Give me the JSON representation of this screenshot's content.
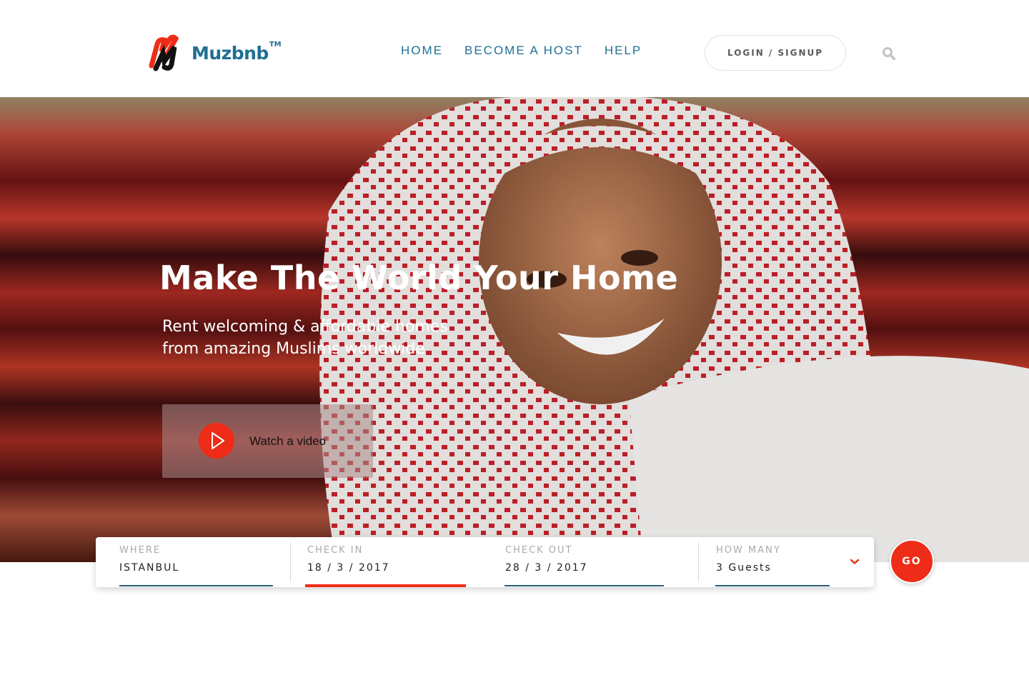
{
  "brand": {
    "name": "Muzbnb",
    "trademark": "TM",
    "primary_color": "#1f6f93",
    "accent_color": "#ee2c17"
  },
  "nav": {
    "items": [
      {
        "label": "HOME"
      },
      {
        "label": "BECOME A HOST"
      },
      {
        "label": "HELP"
      }
    ],
    "login_label": "LOGIN / SIGNUP",
    "search_icon": "search-icon"
  },
  "hero": {
    "title": "Make The World Your Home",
    "subtitle_line1": "Rent welcoming & affordable homes",
    "subtitle_line2": "from amazing Muslims worldwide",
    "video_label": "Watch a video",
    "video_icon": "play-icon"
  },
  "search": {
    "where": {
      "label": "WHERE",
      "value": "ISTANBUL"
    },
    "check_in": {
      "label": "CHECK IN",
      "value": "18 / 3 / 2017"
    },
    "check_out": {
      "label": "CHECK OUT",
      "value": "28 / 3 / 2017"
    },
    "how_many": {
      "label": "HOW MANY",
      "value": "3 Guests"
    },
    "go_label": "GO"
  }
}
